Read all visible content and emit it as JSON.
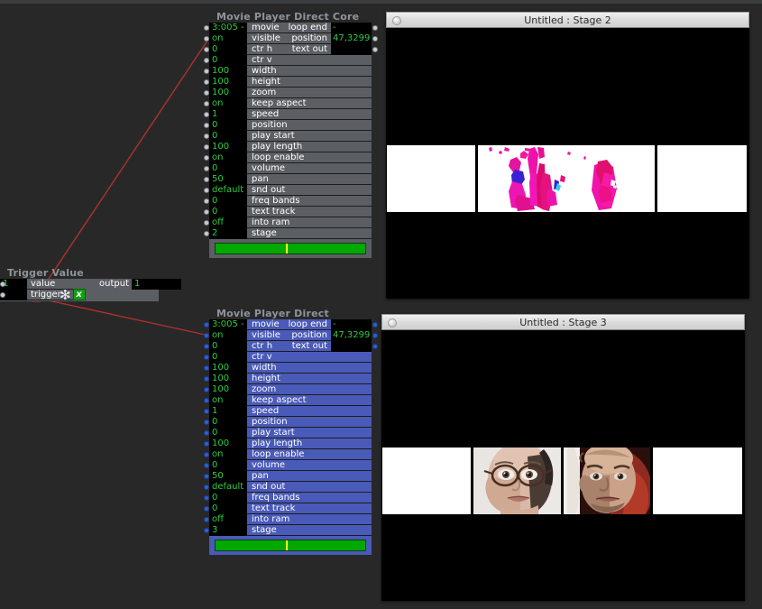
{
  "app": {
    "background_color": "#282828"
  },
  "nodes": [
    {
      "id": "movie-player-direct-core",
      "title": "Movie Player Direct Core",
      "selected": false,
      "stage": "2",
      "inputs": [
        {
          "value": "3:005 -",
          "label": "movie"
        },
        {
          "value": "on",
          "label": "visible"
        },
        {
          "value": "0",
          "label": "ctr h"
        },
        {
          "value": "0",
          "label": "ctr v"
        },
        {
          "value": "100",
          "label": "width"
        },
        {
          "value": "100",
          "label": "height"
        },
        {
          "value": "100",
          "label": "zoom"
        },
        {
          "value": "on",
          "label": "keep aspect"
        },
        {
          "value": "1",
          "label": "speed"
        },
        {
          "value": "0",
          "label": "position"
        },
        {
          "value": "0",
          "label": "play start"
        },
        {
          "value": "100",
          "label": "play length"
        },
        {
          "value": "on",
          "label": "loop enable"
        },
        {
          "value": "0",
          "label": "volume"
        },
        {
          "value": "50",
          "label": "pan"
        },
        {
          "value": "default",
          "label": "snd out"
        },
        {
          "value": "0",
          "label": "freq bands"
        },
        {
          "value": "0",
          "label": "text track"
        },
        {
          "value": "off",
          "label": "into ram"
        },
        {
          "value": "2",
          "label": "stage"
        }
      ],
      "outputs": [
        {
          "label": "loop end",
          "value": "-"
        },
        {
          "label": "position",
          "value": "47,3299"
        },
        {
          "label": "text out",
          "value": ""
        }
      ],
      "scrub": {
        "playhead_percent": 47
      }
    },
    {
      "id": "movie-player-direct",
      "title": "Movie Player Direct",
      "selected": true,
      "stage": "3",
      "inputs": [
        {
          "value": "3:005 -",
          "label": "movie"
        },
        {
          "value": "on",
          "label": "visible"
        },
        {
          "value": "0",
          "label": "ctr h"
        },
        {
          "value": "0",
          "label": "ctr v"
        },
        {
          "value": "100",
          "label": "width"
        },
        {
          "value": "100",
          "label": "height"
        },
        {
          "value": "100",
          "label": "zoom"
        },
        {
          "value": "on",
          "label": "keep aspect"
        },
        {
          "value": "1",
          "label": "speed"
        },
        {
          "value": "0",
          "label": "position"
        },
        {
          "value": "0",
          "label": "play start"
        },
        {
          "value": "100",
          "label": "play length"
        },
        {
          "value": "on",
          "label": "loop enable"
        },
        {
          "value": "0",
          "label": "volume"
        },
        {
          "value": "50",
          "label": "pan"
        },
        {
          "value": "default",
          "label": "snd out"
        },
        {
          "value": "0",
          "label": "freq bands"
        },
        {
          "value": "0",
          "label": "text track"
        },
        {
          "value": "off",
          "label": "into ram"
        },
        {
          "value": "3",
          "label": "stage"
        }
      ],
      "outputs": [
        {
          "label": "loop end",
          "value": "-"
        },
        {
          "label": "position",
          "value": "47,3299"
        },
        {
          "label": "text out",
          "value": ""
        }
      ],
      "scrub": {
        "playhead_percent": 47
      }
    }
  ],
  "trigger_node": {
    "title": "Trigger Value",
    "inputs": [
      {
        "value": "1",
        "label": "value"
      },
      {
        "value": "-",
        "label": "trigger"
      }
    ],
    "output": {
      "label": "output",
      "value": "1"
    },
    "icons": {
      "scatter": "scatter-icon",
      "publish": "x"
    }
  },
  "stages": [
    {
      "id": "stage-2",
      "title": "Untitled : Stage 2"
    },
    {
      "id": "stage-3",
      "title": "Untitled : Stage 3"
    }
  ],
  "colors": {
    "node_fill": "#5b5f64",
    "node_selected_fill": "#4a5ab8",
    "value_text": "#2ecc40",
    "wire": "#b03030",
    "scrub_bar": "#00a800",
    "playhead": "#ffff2a"
  }
}
